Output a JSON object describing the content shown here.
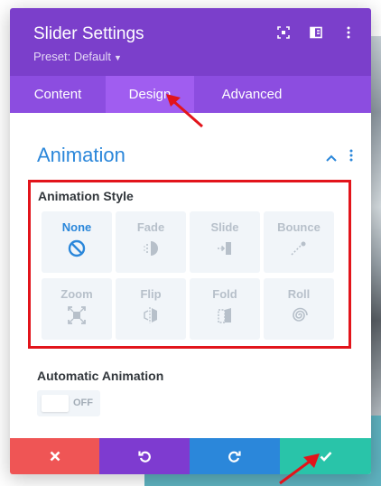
{
  "modal": {
    "title": "Slider Settings",
    "preset": "Preset: Default"
  },
  "tabs": [
    {
      "label": "Content",
      "active": false
    },
    {
      "label": "Design",
      "active": true
    },
    {
      "label": "Advanced",
      "active": false
    }
  ],
  "section": {
    "title": "Animation"
  },
  "animation_style": {
    "label": "Animation Style",
    "selected": "None",
    "options": [
      {
        "label": "None",
        "icon": "none-icon"
      },
      {
        "label": "Fade",
        "icon": "fade-icon"
      },
      {
        "label": "Slide",
        "icon": "slide-icon"
      },
      {
        "label": "Bounce",
        "icon": "bounce-icon"
      },
      {
        "label": "Zoom",
        "icon": "zoom-icon"
      },
      {
        "label": "Flip",
        "icon": "flip-icon"
      },
      {
        "label": "Fold",
        "icon": "fold-icon"
      },
      {
        "label": "Roll",
        "icon": "roll-icon"
      }
    ]
  },
  "automatic_animation": {
    "label": "Automatic Animation",
    "state": "OFF"
  },
  "colors": {
    "header": "#7b3fcb",
    "tabs": "#8c4de0",
    "accent": "#2b87da",
    "highlight": "#e2141b",
    "cancel": "#ef5555",
    "undo": "#7e3bd0",
    "redo": "#2b87da",
    "save": "#29c4a9"
  }
}
